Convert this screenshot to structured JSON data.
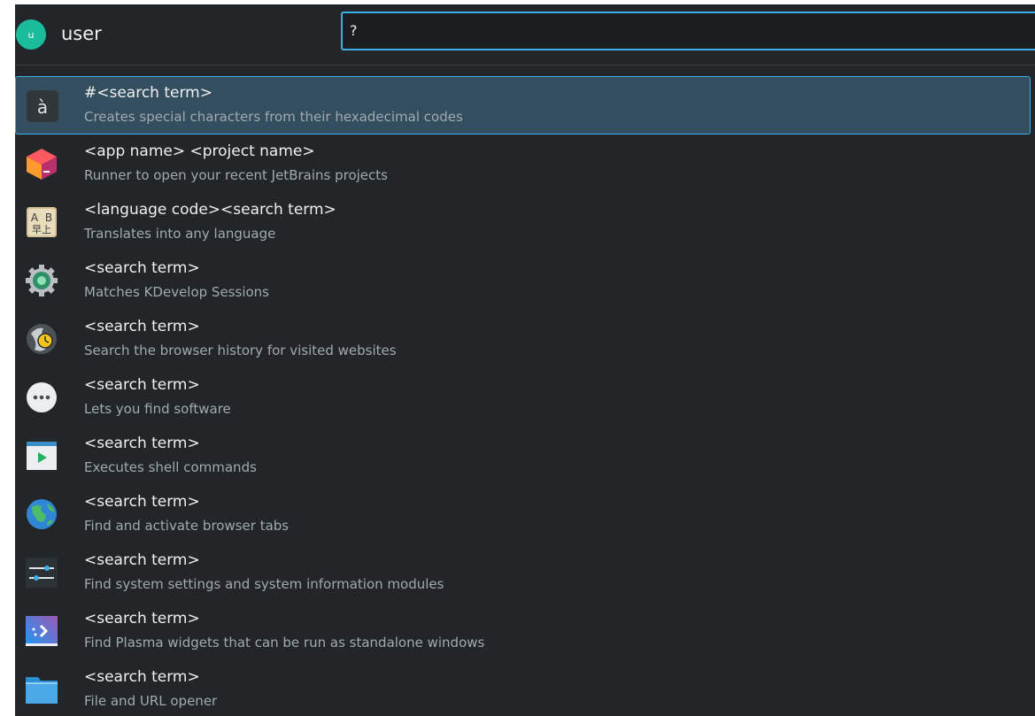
{
  "header": {
    "avatar_letter": "u",
    "username": "user",
    "query": "?"
  },
  "results": [
    {
      "icon": "special-characters-icon",
      "title": "#<search term>",
      "subtitle": "Creates special characters from their hexadecimal codes",
      "selected": true
    },
    {
      "icon": "jetbrains-cube-icon",
      "title": "<app name> <project name>",
      "subtitle": "Runner to open your recent JetBrains projects"
    },
    {
      "icon": "translate-icon",
      "title": "<language code><search term>",
      "subtitle": "Translates into any language"
    },
    {
      "icon": "kdevelop-gear-icon",
      "title": "<search term>",
      "subtitle": "Matches KDevelop Sessions"
    },
    {
      "icon": "browser-history-icon",
      "title": "<search term>",
      "subtitle": "Search the browser history for visited websites"
    },
    {
      "icon": "software-center-icon",
      "title": "<search term>",
      "subtitle": "Lets you find software"
    },
    {
      "icon": "terminal-run-icon",
      "title": "<search term>",
      "subtitle": "Executes shell commands"
    },
    {
      "icon": "globe-icon",
      "title": "<search term>",
      "subtitle": "Find and activate browser tabs"
    },
    {
      "icon": "system-settings-icon",
      "title": "<search term>",
      "subtitle": "Find system settings and system information modules"
    },
    {
      "icon": "plasma-widget-icon",
      "title": "<search term>",
      "subtitle": "Find Plasma widgets that can be run as standalone windows"
    },
    {
      "icon": "folder-icon",
      "title": "<search term>",
      "subtitle": "File and URL opener"
    }
  ]
}
